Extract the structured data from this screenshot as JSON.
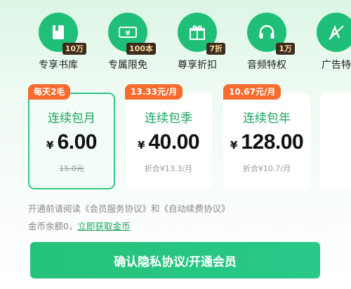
{
  "benefits": [
    {
      "label": "专享书库",
      "tag": "10万",
      "icon": "book-icon"
    },
    {
      "label": "专属限免",
      "tag": "100本",
      "icon": "ticket-yen-icon"
    },
    {
      "label": "尊享折扣",
      "tag": "7折",
      "icon": "gift-box-icon"
    },
    {
      "label": "音频特权",
      "tag": "1万",
      "icon": "headphones-icon"
    },
    {
      "label": "广告特",
      "tag": "",
      "icon": "ad-free-icon"
    }
  ],
  "plans": [
    {
      "badge": "每天2毛",
      "name": "连续包月",
      "currency": "¥",
      "price": "6.00",
      "sub": "15.0元",
      "strike": true,
      "selected": true
    },
    {
      "badge": "13.33元/月",
      "name": "连续包季",
      "currency": "¥",
      "price": "40.00",
      "sub": "折合¥13.3/月",
      "strike": false,
      "selected": false
    },
    {
      "badge": "10.67元/月",
      "name": "连续包年",
      "currency": "¥",
      "price": "128.00",
      "sub": "折合¥10.7/月",
      "strike": false,
      "selected": false
    }
  ],
  "agreement": {
    "prefix": "开通前请阅读",
    "service": "《会员服务协议》",
    "and": "和",
    "renew": "《自动续费协议》"
  },
  "coins": {
    "text": "金币余额0，",
    "link": "立即获取金币"
  },
  "confirm_label": "确认隐私协议/开通会员",
  "colors": {
    "accent": "#1fbf79",
    "badge": "#f56c2e",
    "tag_bg": "#3a2b1c"
  }
}
